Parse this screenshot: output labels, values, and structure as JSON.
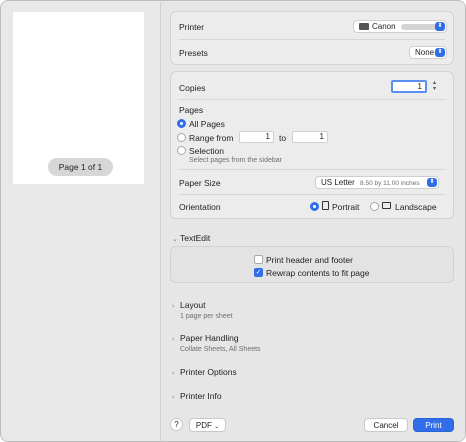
{
  "preview": {
    "page_indicator": "Page 1 of 1"
  },
  "printer": {
    "label": "Printer",
    "value": "Canon"
  },
  "presets": {
    "label": "Presets",
    "value": "None"
  },
  "copies": {
    "label": "Copies",
    "value": "1"
  },
  "pages": {
    "label": "Pages",
    "all_pages": "All Pages",
    "range_from_label": "Range from",
    "range_from": "1",
    "range_to_label": "to",
    "range_to": "1",
    "selection": "Selection",
    "selection_hint": "Select pages from the sidebar"
  },
  "paper_size": {
    "label": "Paper Size",
    "value": "US Letter",
    "detail": "8.50 by 11.00 inches"
  },
  "orientation": {
    "label": "Orientation",
    "portrait": "Portrait",
    "landscape": "Landscape"
  },
  "textedit": {
    "label": "TextEdit",
    "print_header_footer": "Print header and footer",
    "rewrap": "Rewrap contents to fit page"
  },
  "layout": {
    "label": "Layout",
    "summary": "1 page per sheet"
  },
  "paper_handling": {
    "label": "Paper Handling",
    "summary": "Collate Sheets, All Sheets"
  },
  "printer_options": {
    "label": "Printer Options"
  },
  "printer_info": {
    "label": "Printer Info"
  },
  "footer": {
    "help": "?",
    "pdf": "PDF",
    "cancel": "Cancel",
    "print": "Print"
  },
  "colors": {
    "accent": "#2f6ee8"
  }
}
